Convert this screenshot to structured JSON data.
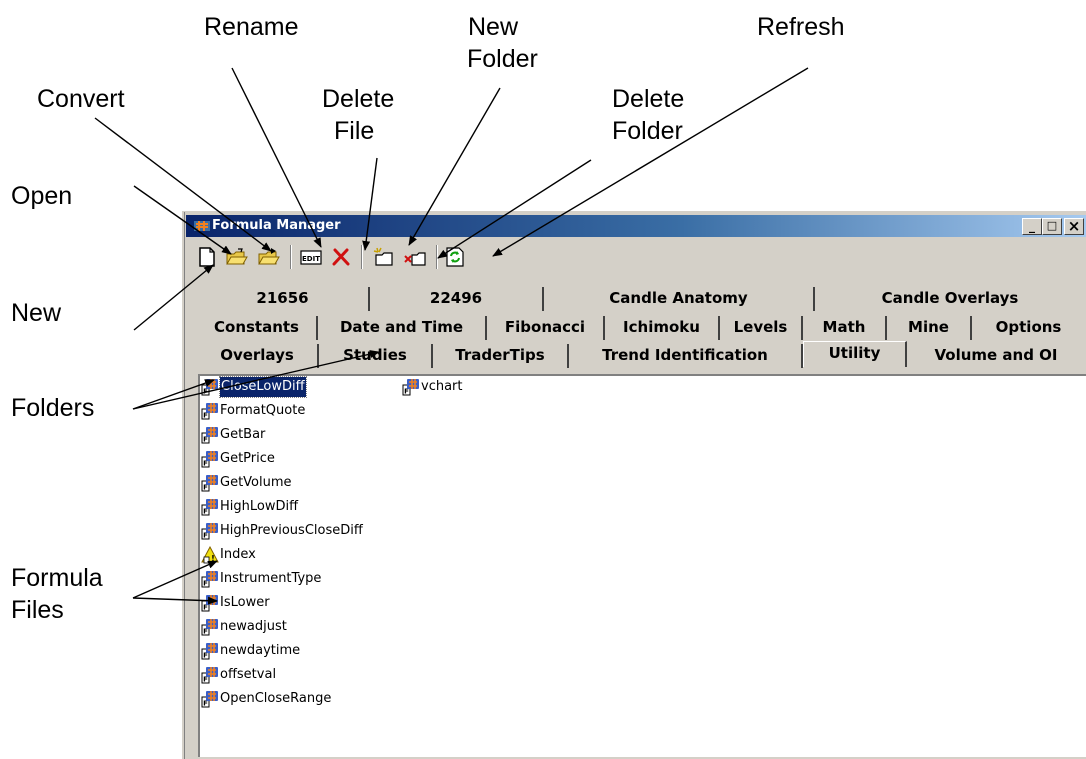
{
  "callouts": {
    "rename": "Rename",
    "new_folder_1": "New",
    "new_folder_2": "Folder",
    "refresh": "Refresh",
    "convert": "Convert",
    "delete_file_1": "Delete",
    "delete_file_2": "File",
    "delete_folder_1": "Delete",
    "delete_folder_2": "Folder",
    "open": "Open",
    "new": "New",
    "folders": "Folders",
    "formula_files_1": "Formula",
    "formula_files_2": "Files"
  },
  "window": {
    "title": "Formula Manager",
    "minimize": "_",
    "maximize": "□",
    "close": "×"
  },
  "toolbar": {
    "buttons": [
      {
        "name": "new",
        "icon": "new-file-icon"
      },
      {
        "name": "open",
        "icon": "open-folder-icon"
      },
      {
        "name": "convert",
        "icon": "convert-folder-icon"
      },
      {
        "name": "rename",
        "icon": "edit-icon",
        "text": "EDIT"
      },
      {
        "name": "delete-file",
        "icon": "red-x-icon"
      },
      {
        "name": "new-folder",
        "icon": "new-folder-icon"
      },
      {
        "name": "delete-folder",
        "icon": "delete-folder-icon"
      },
      {
        "name": "refresh",
        "icon": "refresh-icon"
      }
    ]
  },
  "tabs": {
    "row1": [
      "21656",
      "22496",
      "Candle Anatomy",
      "Candle Overlays"
    ],
    "row2": [
      "Constants",
      "Date and Time",
      "Fibonacci",
      "Ichimoku",
      "Levels",
      "Math",
      "Mine",
      "Options"
    ],
    "row3": [
      "Overlays",
      "Studies",
      "TraderTips",
      "Trend Identification",
      "Utility",
      "Volume and OI"
    ],
    "active": "Utility"
  },
  "files": [
    {
      "label": "CloseLowDiff",
      "icon": "formula-file-icon",
      "selected": true
    },
    {
      "label": "FormatQuote",
      "icon": "formula-file-icon"
    },
    {
      "label": "GetBar",
      "icon": "formula-file-icon"
    },
    {
      "label": "GetPrice",
      "icon": "formula-file-icon"
    },
    {
      "label": "GetVolume",
      "icon": "formula-file-icon"
    },
    {
      "label": "HighLowDiff",
      "icon": "formula-file-icon"
    },
    {
      "label": "HighPreviousCloseDiff",
      "icon": "formula-file-icon"
    },
    {
      "label": "Index",
      "icon": "warning-file-icon"
    },
    {
      "label": "InstrumentType",
      "icon": "formula-file-icon"
    },
    {
      "label": "IsLower",
      "icon": "formula-file-icon"
    },
    {
      "label": "newadjust",
      "icon": "formula-file-icon"
    },
    {
      "label": "newdaytime",
      "icon": "formula-file-icon"
    },
    {
      "label": "offsetval",
      "icon": "formula-file-icon"
    },
    {
      "label": "OpenCloseRange",
      "icon": "formula-file-icon"
    },
    {
      "label": "vchart",
      "icon": "formula-file-icon"
    }
  ],
  "colors": {
    "titlebar_start": "#0a246a",
    "titlebar_end": "#a6caf0",
    "face": "#d4d0c8",
    "selection": "#0a246a"
  }
}
